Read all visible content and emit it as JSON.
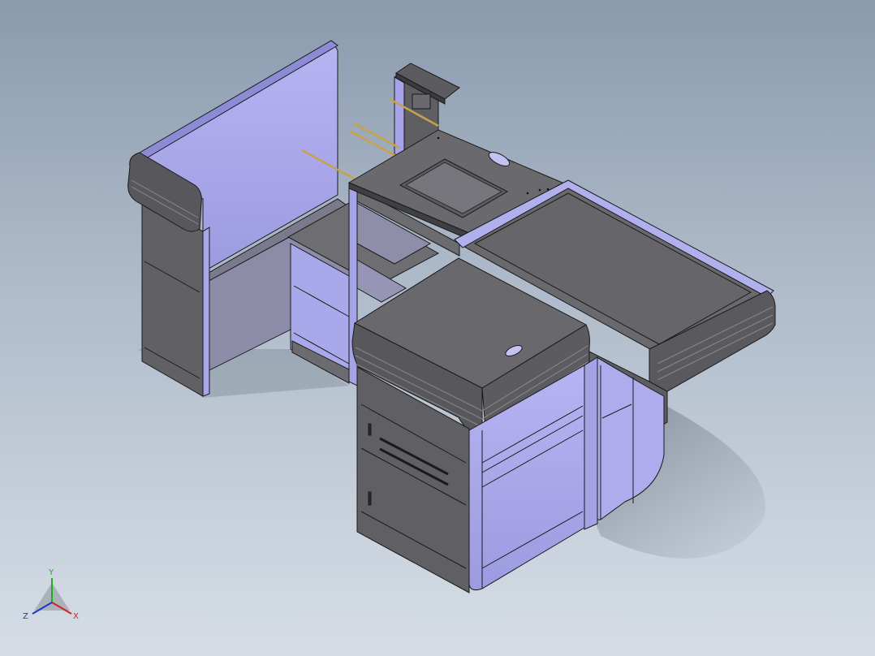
{
  "viewport": {
    "background_top": "#8a9bae",
    "background_bottom": "#d6dde6"
  },
  "model": {
    "colors": {
      "dark_face": "#5e5e62",
      "mid_face": "#707074",
      "light_face": "#a9a8e8",
      "lavender": "#b8b6f0",
      "edge": "#1a1a1a",
      "brass": "#c8a24a"
    }
  },
  "triad": {
    "y_label": "Y",
    "x_label": "X",
    "z_label": "Z",
    "y_color": "#22aa22",
    "x_color": "#cc2222",
    "z_color": "#2233cc"
  }
}
